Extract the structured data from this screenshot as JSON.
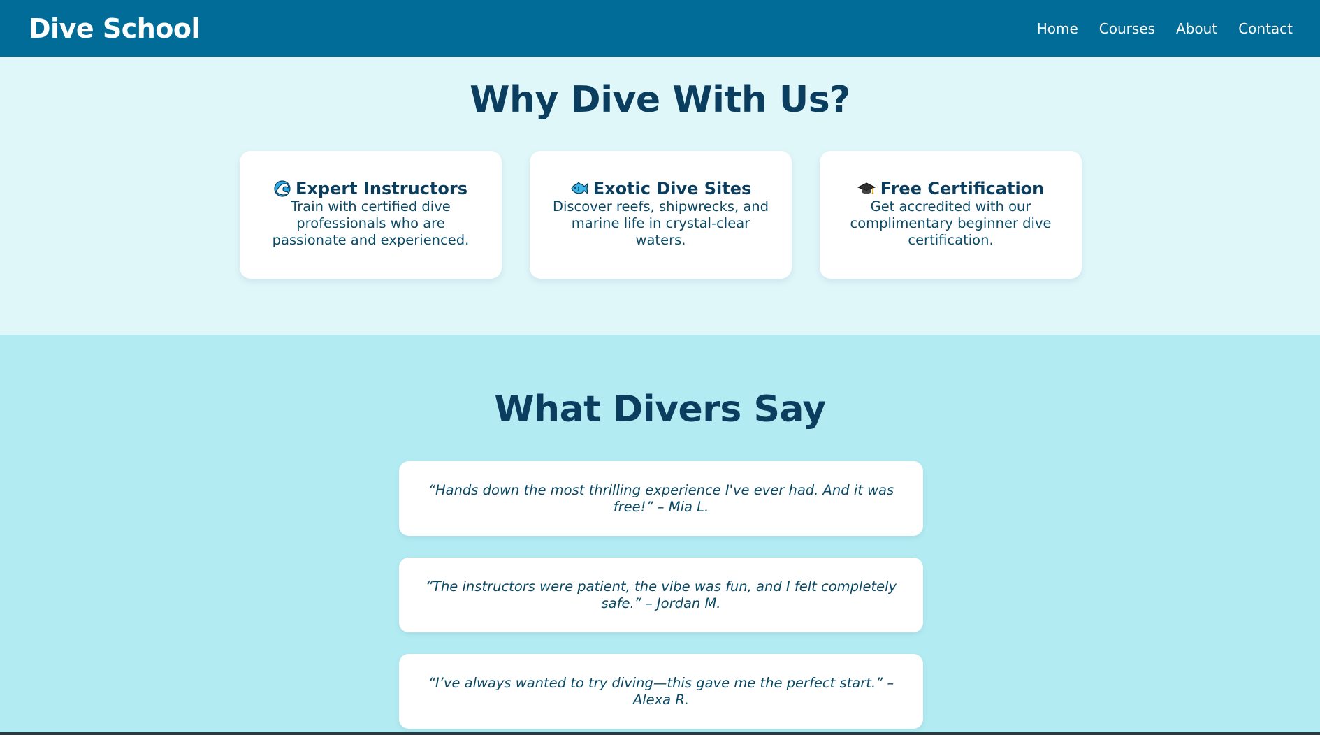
{
  "header": {
    "brand": "Dive School",
    "nav": [
      "Home",
      "Courses",
      "About",
      "Contact"
    ]
  },
  "why": {
    "title": "Why Dive With Us?",
    "cards": [
      {
        "icon": "wave-icon",
        "title": "Expert Instructors",
        "description": "Train with certified dive professionals who are passionate and experienced."
      },
      {
        "icon": "fish-icon",
        "title": "Exotic Dive Sites",
        "description": "Discover reefs, shipwrecks, and marine life in crystal-clear waters."
      },
      {
        "icon": "graduation-cap-icon",
        "title": "Free Certification",
        "description": "Get accredited with our complimentary beginner dive certification."
      }
    ]
  },
  "testimonials": {
    "title": "What Divers Say",
    "quotes": [
      "“Hands down the most thrilling experience I've ever had. And it was free!” – Mia L.",
      "“The instructors were patient, the vibe was fun, and I felt completely safe.” – Jordan M.",
      "“I’ve always wanted to try diving—this gave me the perfect start.” – Alexa R."
    ]
  },
  "colors": {
    "header": "#006c97",
    "why_bg": "#e0f7fa",
    "testimonials_bg": "#b3ebf2",
    "heading": "#0b3e5e"
  }
}
